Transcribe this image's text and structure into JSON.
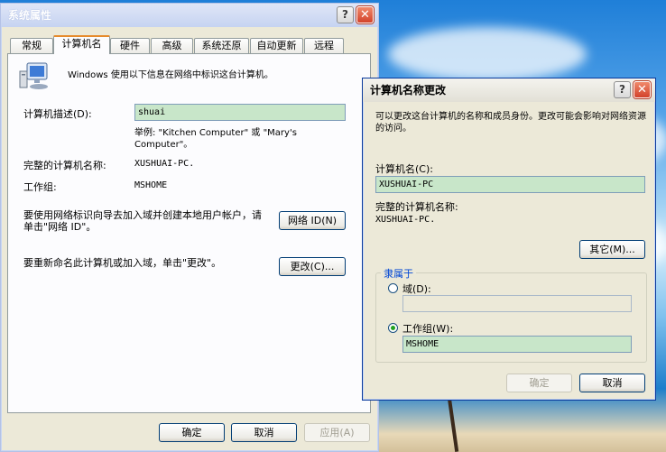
{
  "sysprops": {
    "title": "系统属性",
    "tabs": [
      "常规",
      "计算机名",
      "硬件",
      "高级",
      "系统还原",
      "自动更新",
      "远程"
    ],
    "selected_tab": "计算机名",
    "intro": "Windows 使用以下信息在网络中标识这台计算机。",
    "desc_label": "计算机描述(D):",
    "desc_value": "shuai",
    "example": "举例: \"Kitchen Computer\" 或 \"Mary's Computer\"。",
    "fullname_label": "完整的计算机名称:",
    "fullname_value": "XUSHUAI-PC.",
    "workgroup_label": "工作组:",
    "workgroup_value": "MSHOME",
    "netid_text": "要使用网络标识向导去加入域并创建本地用户帐户，请单击\"网络 ID\"。",
    "netid_button": "网络 ID(N)",
    "rename_text": "要重新命名此计算机或加入域，单击\"更改\"。",
    "change_button": "更改(C)...",
    "ok": "确定",
    "cancel": "取消",
    "apply": "应用(A)"
  },
  "rename": {
    "title": "计算机名称更改",
    "intro": "可以更改这台计算机的名称和成员身份。更改可能会影响对网络资源的访问。",
    "name_label": "计算机名(C):",
    "name_value": "XUSHUAI-PC",
    "fullname_label": "完整的计算机名称:",
    "fullname_value": "XUSHUAI-PC.",
    "more_button": "其它(M)...",
    "member_group": "隶属于",
    "domain_label": "域(D):",
    "domain_value": "",
    "workgroup_label": "工作组(W):",
    "workgroup_value": "MSHOME",
    "ok": "确定",
    "cancel": "取消"
  },
  "colors": {
    "field_green": "#c8e6c9",
    "accent_link": "#0046d5"
  }
}
